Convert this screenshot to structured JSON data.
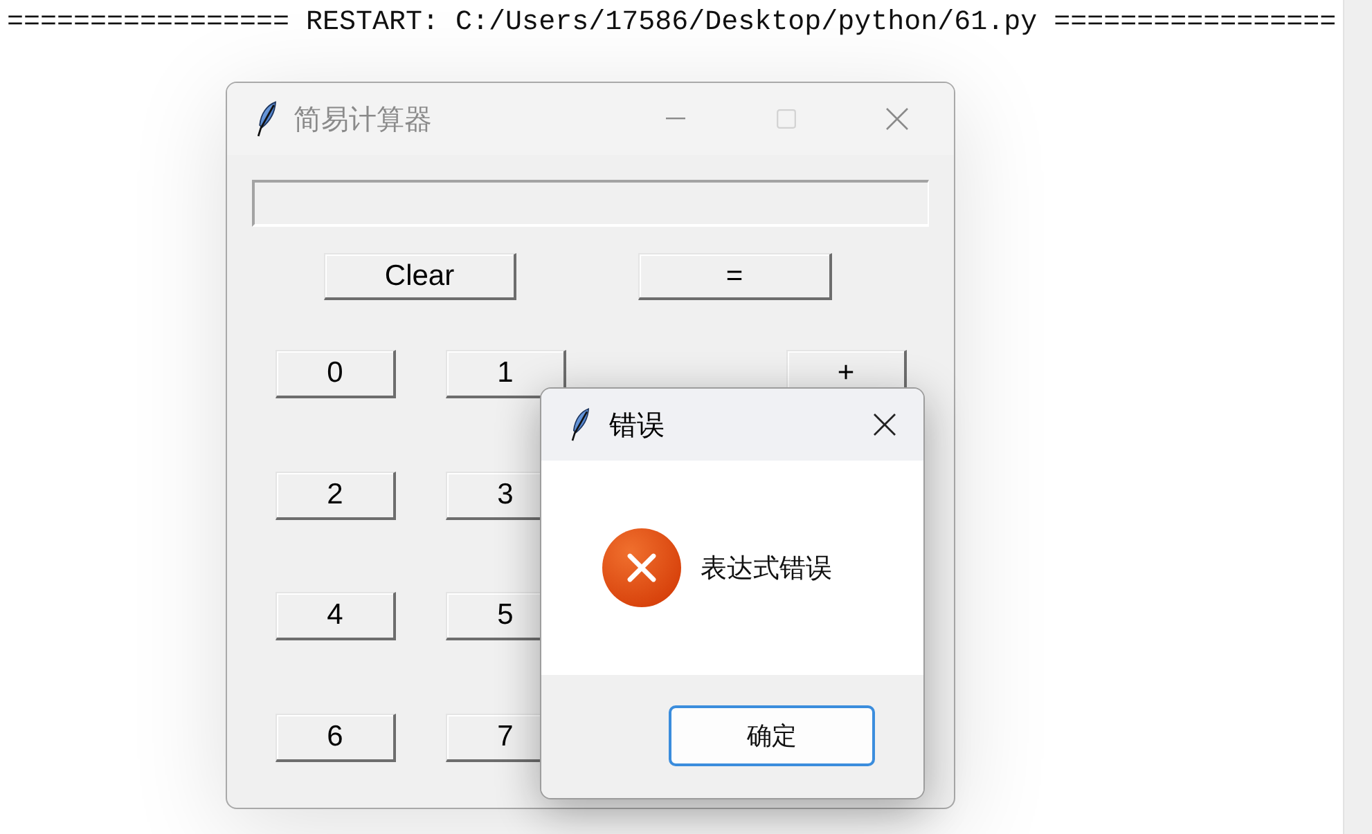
{
  "shell": {
    "restart_line": "================= RESTART: C:/Users/17586/Desktop/python/61.py ================="
  },
  "calculator_window": {
    "title": "简易计算器",
    "active": false,
    "title_buttons": [
      {
        "kind": "minimize",
        "disabled": false
      },
      {
        "kind": "maximize",
        "disabled": true
      },
      {
        "kind": "close",
        "disabled": false
      }
    ],
    "top_buttons": [
      {
        "label": "Clear"
      },
      {
        "label": "="
      }
    ],
    "key_rows": [
      {
        "digits": [
          "0",
          "1"
        ],
        "operator": "+"
      },
      {
        "digits": [
          "2",
          "3"
        ]
      },
      {
        "digits": [
          "4",
          "5"
        ]
      },
      {
        "digits": [
          "6",
          "7"
        ]
      }
    ]
  },
  "dialog": {
    "title": "错误",
    "active": true,
    "title_buttons": [
      {
        "kind": "close",
        "disabled": false
      }
    ],
    "icon": {
      "kind": "error"
    },
    "message": "表达式错误",
    "buttons": [
      {
        "label": "确定",
        "focused": true
      }
    ]
  }
}
